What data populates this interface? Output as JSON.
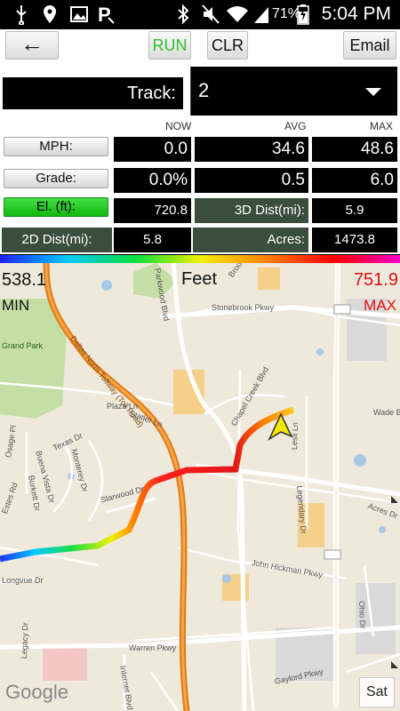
{
  "status_bar": {
    "time": "5:04 PM",
    "battery_percent": "71%",
    "icons": [
      "usb-icon",
      "location-icon",
      "image-icon",
      "parking-icon",
      "bluetooth-icon",
      "mute-icon",
      "wifi-icon",
      "signal-icon",
      "battery-charging-icon"
    ]
  },
  "toolbar": {
    "back_label": "←",
    "run_label": "RUN",
    "clr_label": "CLR",
    "email_label": "Email"
  },
  "track": {
    "label": "Track:",
    "value": "2"
  },
  "stats": {
    "columns": {
      "now": "NOW",
      "avg": "AVG",
      "max": "MAX"
    },
    "mph": {
      "label": "MPH:",
      "now": "0.0",
      "avg": "34.6",
      "max": "48.6"
    },
    "grade": {
      "label": "Grade:",
      "now": "0.0%",
      "avg": "0.5",
      "max": "6.0"
    },
    "elevation": {
      "label": "El. (ft):",
      "now": "720.8",
      "dist3d_label": "3D Dist(mi):",
      "dist3d_value": "5.9"
    },
    "dist2d": {
      "label": "2D Dist(mi):",
      "value": "5.8",
      "acres_label": "Acres:",
      "acres_value": "1473.8"
    }
  },
  "map": {
    "min_value": "538.1",
    "min_label": "MIN",
    "unit_label": "Feet",
    "max_value": "751.9",
    "max_label": "MAX",
    "google_logo": "Google",
    "sat_label": "Sat",
    "road_labels": [
      "Dallas North Tollway (Toll Road)",
      "Stonebrook Pkwy",
      "Parkwood Blvd",
      "Brookview Dr",
      "Grand Park",
      "Texas Dr",
      "Starwood Dr",
      "Legendary Dr",
      "John Hickman Pkwy",
      "Warren Pkwy",
      "Gaylord Pkwy",
      "Internet Blvd",
      "Chapel Creek Blvd",
      "Wade Blvd",
      "Lesli Ln",
      "Acres Dr",
      "Longvue Dr",
      "Legacy Dr",
      "Ohio Dr",
      "Osage Pl",
      "Buena Vista Dr",
      "Monterey Dr",
      "Burkett Dr",
      "Plaza Ln",
      "Statler Ln",
      "Estes Rd"
    ],
    "colors": {
      "route_low": "#2020ff",
      "route_high": "#ff2020",
      "tollway": "#e07b14",
      "park": "#c5dea6",
      "water": "#a8c8e8"
    }
  }
}
